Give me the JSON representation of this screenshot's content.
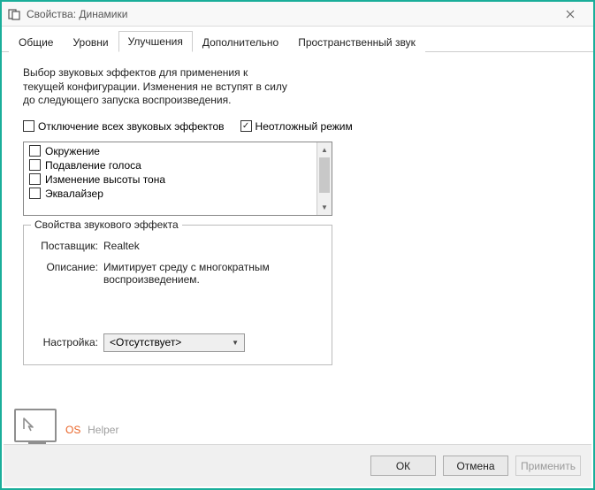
{
  "window": {
    "title": "Свойства: Динамики"
  },
  "tabs": {
    "t0": "Общие",
    "t1": "Уровни",
    "t2": "Улучшения",
    "t3": "Дополнительно",
    "t4": "Пространственный звук"
  },
  "description": "Выбор звуковых эффектов для применения к текущей конфигурации. Изменения не вступят в силу до следующего запуска воспроизведения.",
  "toggles": {
    "disable_all": "Отключение всех звуковых эффектов",
    "immediate": "Неотложный режим"
  },
  "effects": {
    "e0": "Окружение",
    "e1": "Подавление голоса",
    "e2": "Изменение высоты тона",
    "e3": "Эквалайзер"
  },
  "props": {
    "group_title": "Свойства звукового эффекта",
    "vendor_label": "Поставщик:",
    "vendor_value": "Realtek",
    "desc_label": "Описание:",
    "desc_value": "Имитирует среду с многократным воспроизведением.",
    "setting_label": "Настройка:",
    "setting_value": "<Отсутствует>"
  },
  "buttons": {
    "ok": "ОК",
    "cancel": "Отмена",
    "apply": "Применить"
  },
  "watermark": {
    "os": "OS",
    "helper": "Helper"
  }
}
